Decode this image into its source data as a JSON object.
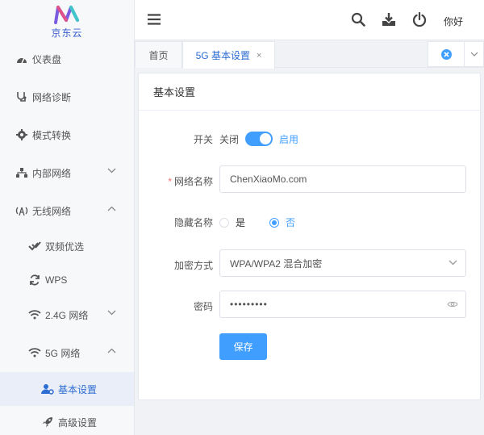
{
  "brand": {
    "logo_text": "京东云"
  },
  "sidebar": {
    "items": [
      {
        "label": "仪表盘"
      },
      {
        "label": "网络诊断"
      },
      {
        "label": "模式转换"
      },
      {
        "label": "内部网络"
      },
      {
        "label": "无线网络"
      },
      {
        "label": "双频优选"
      },
      {
        "label": "WPS"
      },
      {
        "label": "2.4G 网络"
      },
      {
        "label": "5G 网络"
      },
      {
        "label": "基本设置"
      },
      {
        "label": "高级设置"
      }
    ]
  },
  "header": {
    "greeting": "你好"
  },
  "tabs": [
    {
      "label": "首页"
    },
    {
      "label": "5G 基本设置",
      "close": "×"
    }
  ],
  "form": {
    "title": "基本设置",
    "switch": {
      "label": "开关",
      "off_text": "关闭",
      "on_text": "启用",
      "on": true
    },
    "ssid": {
      "label": "网络名称",
      "required": "*",
      "value": "ChenXiaoMo.com"
    },
    "hidden": {
      "label": "隐藏名称",
      "options": [
        "是",
        "否"
      ],
      "selected": "否"
    },
    "encryption": {
      "label": "加密方式",
      "value": "WPA/WPA2 混合加密"
    },
    "password": {
      "label": "密码",
      "value": "•••••••••"
    },
    "save_label": "保存"
  },
  "colors": {
    "accent": "#409eff",
    "active_bg": "#e9eef9",
    "active_text": "#2d6cd2",
    "required": "#f56c6c"
  }
}
